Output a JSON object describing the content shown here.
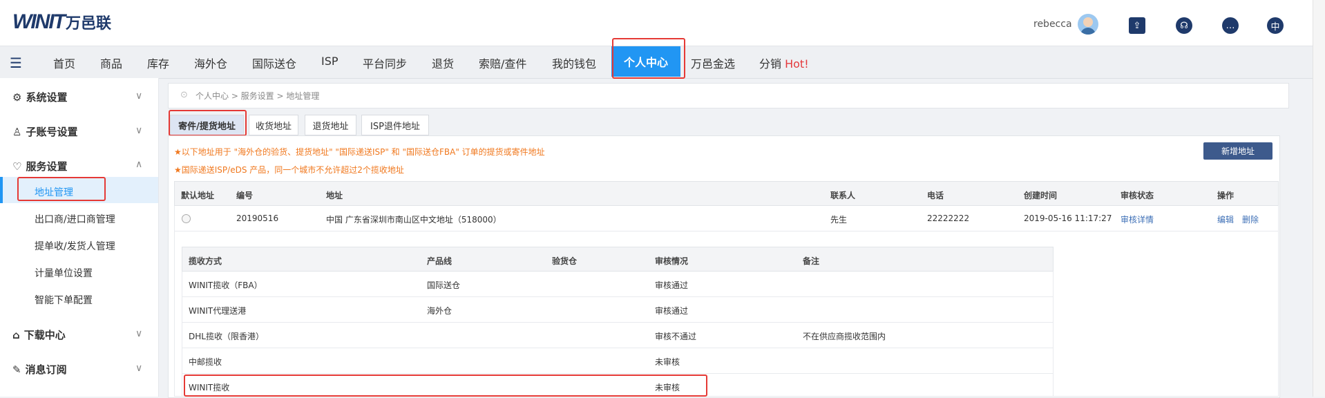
{
  "header": {
    "logo_mark": "WINIT",
    "logo_cn": "万邑联",
    "user_name": "rebecca",
    "lang_label": "中"
  },
  "nav": {
    "items": [
      "首页",
      "商品",
      "库存",
      "海外仓",
      "国际送仓",
      "ISP",
      "平台同步",
      "退货",
      "索赔/查件",
      "我的钱包",
      "个人中心",
      "万邑金选",
      "分销"
    ],
    "hot_label": "Hot!"
  },
  "sidebar": {
    "groups": [
      "系统设置",
      "子账号设置",
      "服务设置",
      "下载中心",
      "消息订阅"
    ],
    "sub_items": [
      "地址管理",
      "出口商/进口商管理",
      "提单收/发货人管理",
      "计量单位设置",
      "智能下单配置"
    ]
  },
  "breadcrumb": "个人中心 > 服务设置 > 地址管理",
  "tabs": [
    "寄件/提货地址",
    "收货地址",
    "退货地址",
    "ISP退件地址"
  ],
  "notices": [
    "★以下地址用于 \"海外仓的验货、提货地址\" \"国际递送ISP\" 和 \"国际送仓FBA\" 订单的提货或寄件地址",
    "★国际递送ISP/eDS 产品，同一个城市不允许超过2个揽收地址"
  ],
  "add_button": "新增地址",
  "table": {
    "headers": [
      "默认地址",
      "编号",
      "地址",
      "联系人",
      "电话",
      "创建时间",
      "审核状态",
      "操作"
    ],
    "rows": [
      {
        "id": "20190516",
        "address": "中国 广东省深圳市南山区中文地址（518000）",
        "contact": "先生",
        "phone": "22222222",
        "created": "2019-05-16 11:17:27",
        "status_link": "审核详情",
        "edit": "编辑",
        "delete": "删除"
      }
    ]
  },
  "sub_table": {
    "headers": [
      "揽收方式",
      "产品线",
      "验货仓",
      "审核情况",
      "备注"
    ],
    "rows": [
      [
        "WINIT揽收（FBA）",
        "国际送仓",
        "",
        "审核通过",
        ""
      ],
      [
        "WINIT代理送港",
        "海外仓",
        "",
        "审核通过",
        ""
      ],
      [
        "DHL揽收（限香港）",
        "",
        "",
        "审核不通过",
        "不在供应商揽收范围内"
      ],
      [
        "中邮揽收",
        "",
        "",
        "未审核",
        ""
      ],
      [
        "WINIT揽收",
        "",
        "",
        "未审核",
        ""
      ]
    ]
  },
  "colors": {
    "accent": "#2196f3",
    "brand": "#1f3a6b",
    "notice": "#f0781e",
    "highlight": "#e53935"
  }
}
